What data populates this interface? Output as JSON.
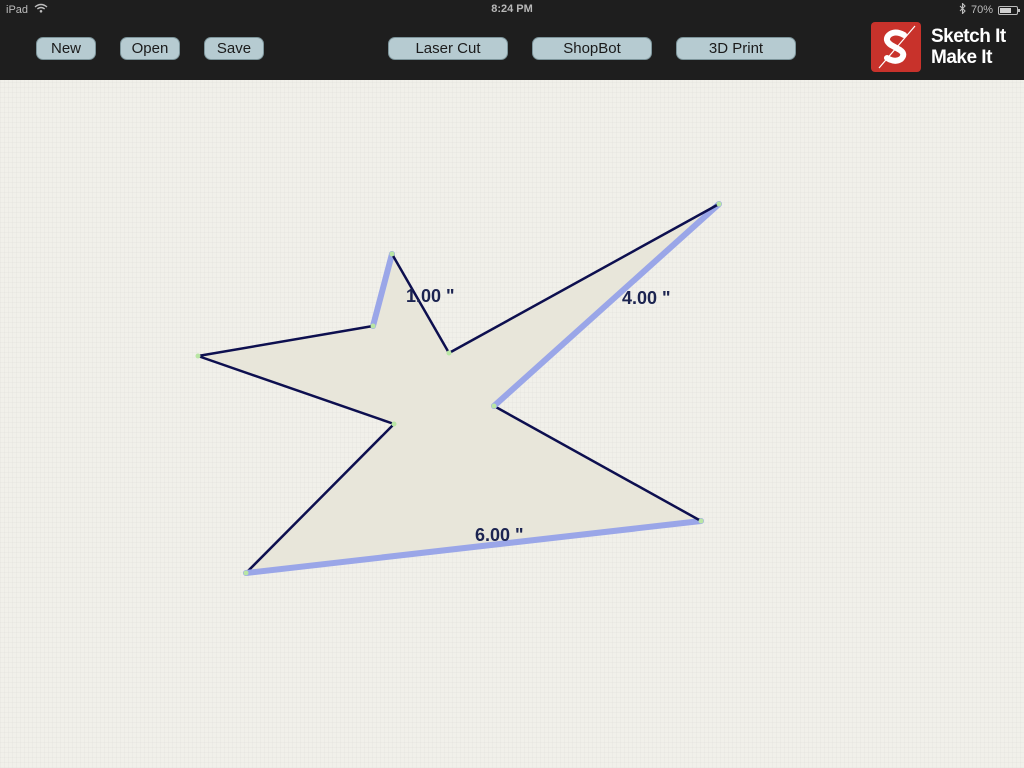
{
  "status_bar": {
    "device": "iPad",
    "time": "8:24 PM",
    "battery_percent": "70%",
    "battery_level": 0.7,
    "icons": [
      "wifi-icon",
      "bluetooth-icon",
      "battery-icon"
    ]
  },
  "toolbar": {
    "new_label": "New",
    "open_label": "Open",
    "save_label": "Save",
    "laser_cut_label": "Laser Cut",
    "shopbot_label": "ShopBot",
    "print_3d_label": "3D Print"
  },
  "logo": {
    "line1": "Sketch It",
    "line2": "Make It",
    "brand_color": "#c8322b"
  },
  "drawing": {
    "fill_color": "#e8e6da",
    "edge_color": "#0d0f4f",
    "selected_edge_color": "#9aa6e8",
    "vertex_color": "#b9e6a4",
    "dimension_labels": [
      "1.00 \"",
      "4.00 \"",
      "6.00 \""
    ]
  }
}
